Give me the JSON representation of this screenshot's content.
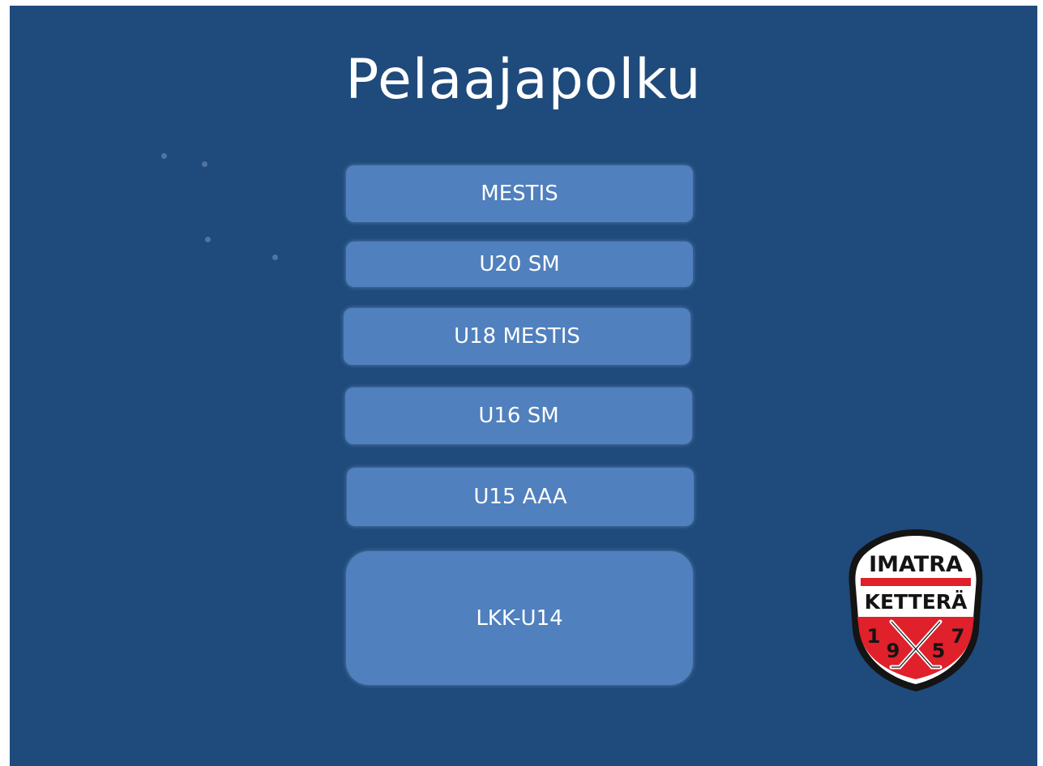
{
  "title": "Pelaajapolku",
  "levels": [
    "MESTIS",
    "U20 SM",
    "U18 MESTIS",
    "U16 SM",
    "U15 AAA",
    "LKK-U14"
  ],
  "logo": {
    "top_text": "IMATRA",
    "middle_text": "KETTERÄ",
    "year_digits": [
      "1",
      "9",
      "5",
      "7"
    ]
  },
  "colors": {
    "background": "#1f4a7c",
    "box": "#5080bd",
    "logo_red": "#e0202a"
  }
}
